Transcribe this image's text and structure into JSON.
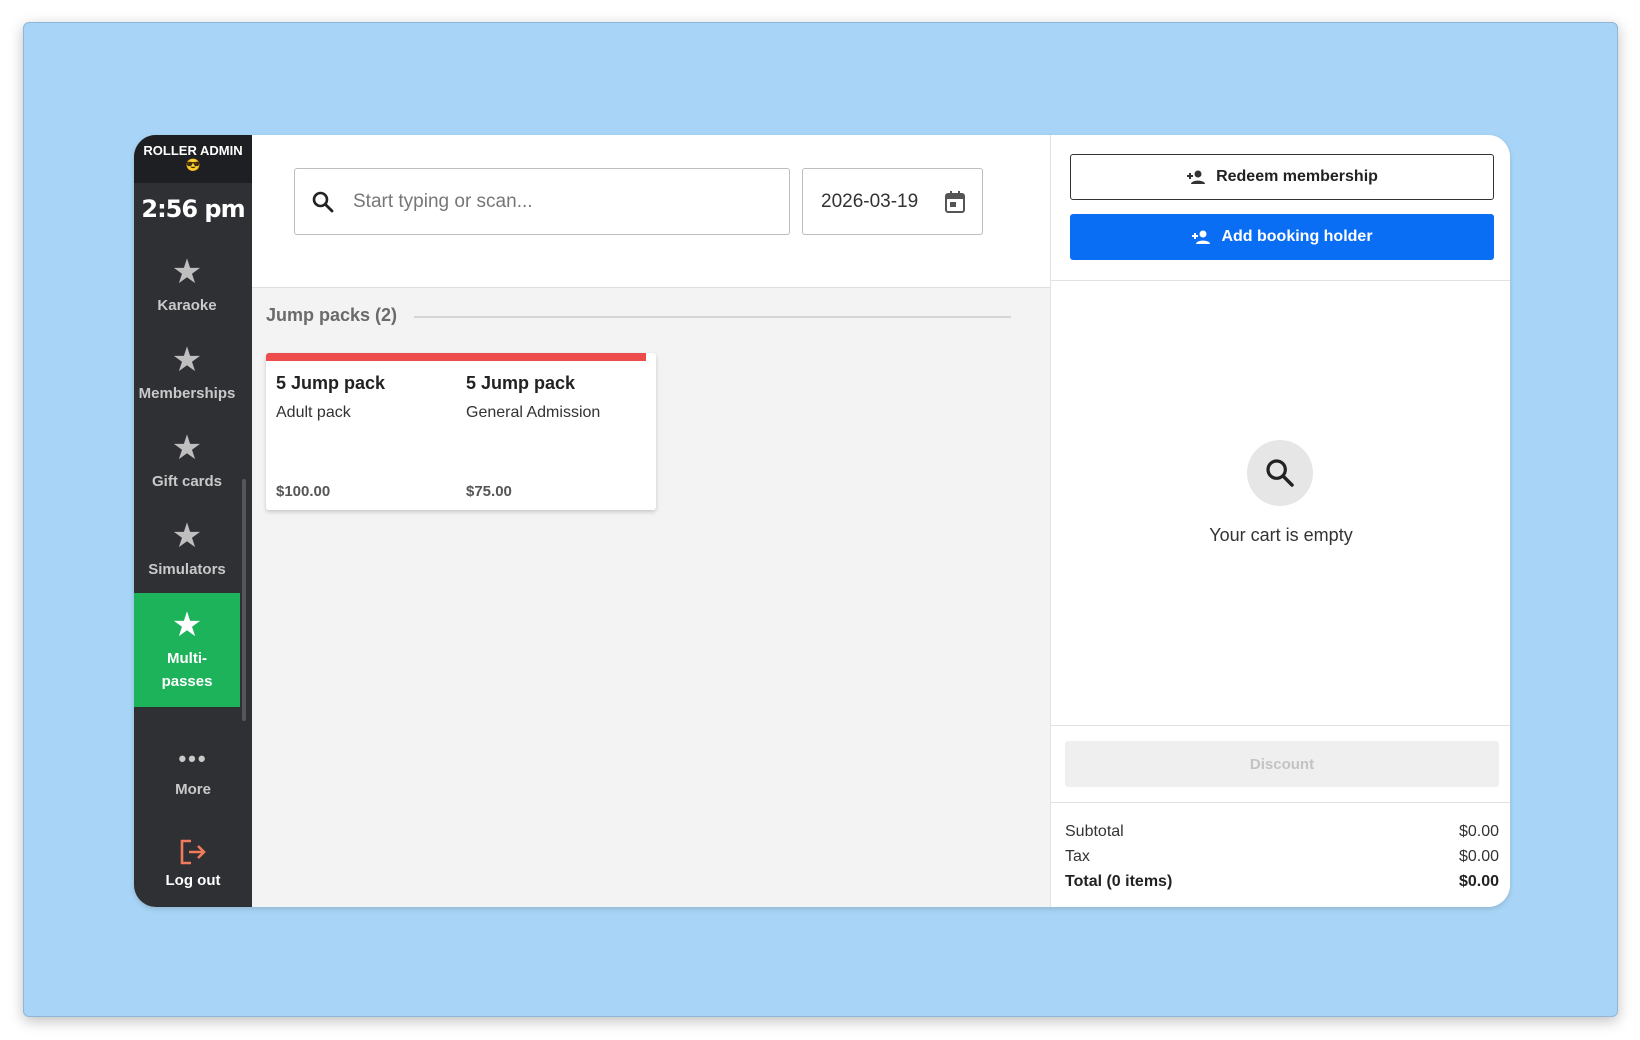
{
  "sidebar": {
    "brand": "ROLLER ADMIN",
    "brand_emoji": "😎",
    "clock": "2:56 pm",
    "items": [
      {
        "label": "Karaoke",
        "icon": "star-icon"
      },
      {
        "label": "Memberships",
        "icon": "star-icon"
      },
      {
        "label": "Gift cards",
        "icon": "star-icon"
      },
      {
        "label": "Simulators",
        "icon": "star-icon"
      },
      {
        "label": "Multi-passes",
        "icon": "star-icon",
        "active": true
      }
    ],
    "multipasses_line1": "Multi-",
    "multipasses_line2": "passes",
    "more_label": "More",
    "logout_label": "Log out"
  },
  "topbar": {
    "search_placeholder": "Start typing or scan...",
    "date_value": "2026-03-19"
  },
  "section": {
    "title": "Jump packs (2)"
  },
  "products": [
    {
      "name": "5 Jump pack",
      "subtitle": "Adult pack",
      "price": "$100.00"
    },
    {
      "name": "5 Jump pack",
      "subtitle": "General Admission",
      "price": "$75.00"
    }
  ],
  "cart": {
    "redeem_label": "Redeem membership",
    "add_holder_label": "Add booking holder",
    "empty_text": "Your cart is empty",
    "discount_label": "Discount",
    "subtotal_label": "Subtotal",
    "subtotal_value": "$0.00",
    "tax_label": "Tax",
    "tax_value": "$0.00",
    "total_label": "Total (0 items)",
    "total_value": "$0.00"
  },
  "colors": {
    "active_nav": "#1db35b",
    "primary_button": "#0a6ef5",
    "card_accent": "#ec4c4c",
    "backdrop": "#a8d5f7",
    "logout_icon": "#f07b5a"
  }
}
